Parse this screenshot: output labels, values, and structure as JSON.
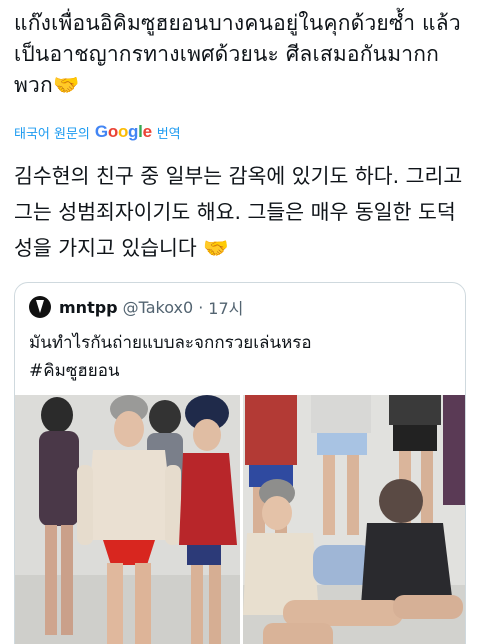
{
  "post": {
    "text_th": "แก๊งเพื่อนอิคิมซูฮยอนบางคนอยู่ในคุกด้วยซ้ำ แล้วเป็นอาชญากรทางเพศด้วยนะ ศีลเสมอกันมากกพวก🤝",
    "translate_prefix": "태국어 원문의",
    "translate_brand": "Google",
    "translate_suffix": "번역",
    "translated_text": "김수현의 친구 중 일부는 감옥에 있기도 하다. 그리고 그는 성범죄자이기도 해요. 그들은 매우 동일한 도덕성을 가지고 있습니다 🤝"
  },
  "quote": {
    "display_name": "mntpp",
    "handle": "@Takox0",
    "dot": "·",
    "time": "17시",
    "text_line1": "มันทำไรกันถ่ายแบบละจกกรวยเล่นหรอ",
    "text_line2": "#คิมซูฮยอน"
  },
  "icons": {
    "handshake": "handshake-emoji-icon",
    "avatar": "profile-avatar"
  },
  "colors": {
    "link": "#1d9bf0",
    "text": "#0f1419",
    "secondary": "#536471",
    "border": "#cfd9de"
  }
}
